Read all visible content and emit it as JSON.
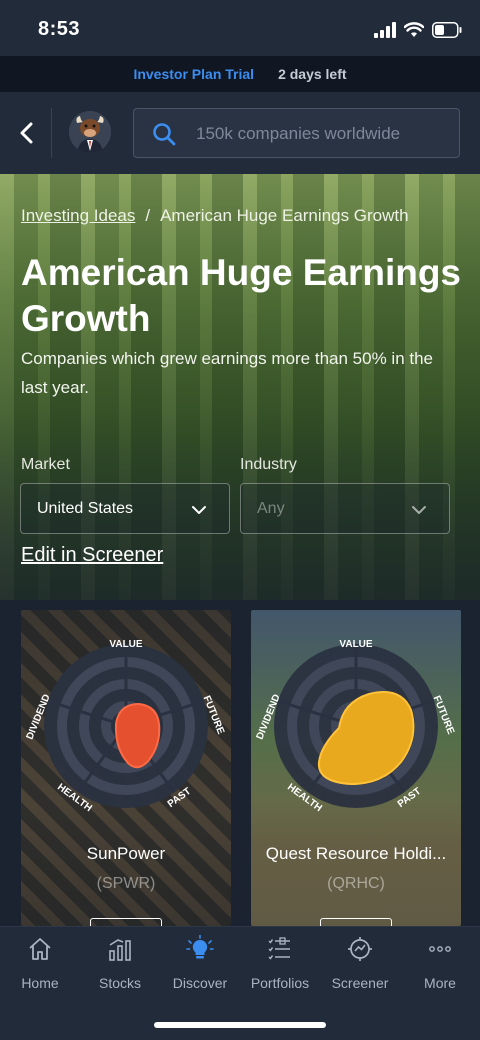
{
  "status": {
    "time": "8:53"
  },
  "trial": {
    "plan": "Investor Plan Trial",
    "remaining": "2 days left"
  },
  "search": {
    "placeholder": "150k companies worldwide"
  },
  "breadcrumb": {
    "parent": "Investing Ideas",
    "separator": "/",
    "current": "American Huge Earnings Growth"
  },
  "page": {
    "title": "American Huge Earnings Growth",
    "description": "Companies which grew earnings more than 50% in the last year."
  },
  "filters": {
    "market_label": "Market",
    "market_value": "United States",
    "industry_label": "Industry",
    "industry_value": "Any"
  },
  "edit_link": "Edit in Screener",
  "radar_axes": {
    "value": "VALUE",
    "future": "FUTURE",
    "past": "PAST",
    "health": "HEALTH",
    "dividend": "DIVIDEND"
  },
  "companies": [
    {
      "name": "SunPower",
      "ticker": "(SPWR)",
      "color": "#e5502f"
    },
    {
      "name": "Quest Resource Holdi...",
      "ticker": "(QRHC)",
      "color": "#e8a91f"
    }
  ],
  "tabs": [
    {
      "label": "Home",
      "icon": "home-icon"
    },
    {
      "label": "Stocks",
      "icon": "stocks-icon"
    },
    {
      "label": "Discover",
      "icon": "discover-bulb-icon"
    },
    {
      "label": "Portfolios",
      "icon": "portfolios-icon"
    },
    {
      "label": "Screener",
      "icon": "screener-icon"
    },
    {
      "label": "More",
      "icon": "more-icon"
    }
  ],
  "colors": {
    "accent": "#3b8df0",
    "background": "#1b2230",
    "panel": "#222b39"
  }
}
